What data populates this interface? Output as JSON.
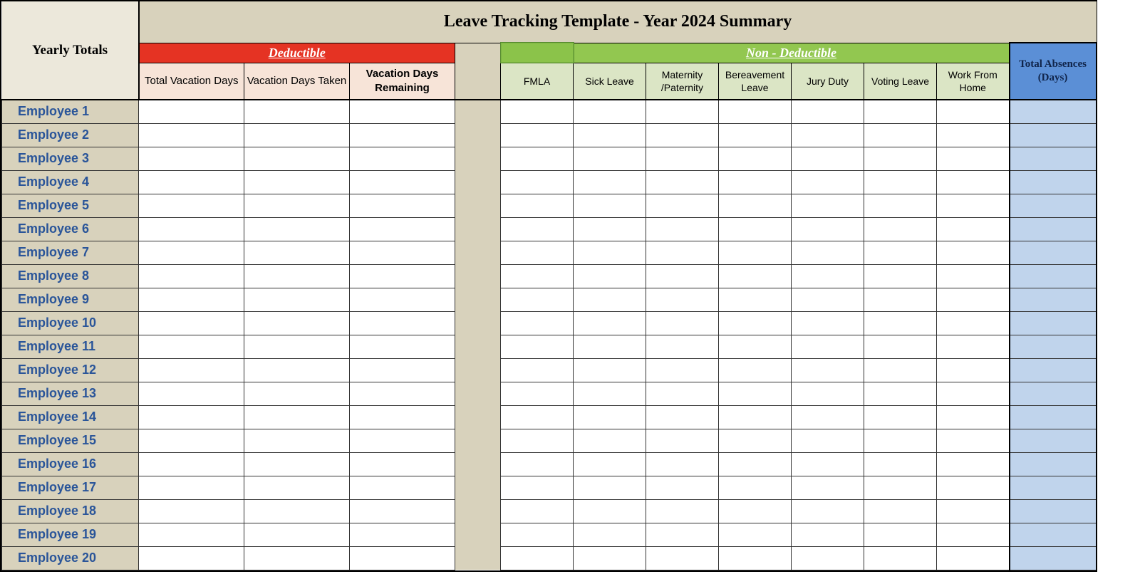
{
  "title": "Leave Tracking Template - Year 2024 Summary",
  "yearly_totals_label": "Yearly Totals",
  "deductible": {
    "header": "Deductible",
    "columns": [
      "Total Vacation Days",
      "Vacation Days Taken",
      "Vacation Days Remaining"
    ]
  },
  "nondeductible": {
    "header": "Non - Deductible",
    "columns": [
      "FMLA",
      "Sick Leave",
      "Maternity /Paternity",
      "Bereavement Leave",
      "Jury Duty",
      "Voting Leave",
      "Work From Home"
    ]
  },
  "total_absences_header": "Total Absences (Days)",
  "employees": [
    "Employee 1",
    "Employee 2",
    "Employee 3",
    "Employee 4",
    "Employee 5",
    "Employee 6",
    "Employee 7",
    "Employee 8",
    "Employee 9",
    "Employee 10",
    "Employee 11",
    "Employee 12",
    "Employee 13",
    "Employee 14",
    "Employee 15",
    "Employee 16",
    "Employee 17",
    "Employee 18",
    "Employee 19",
    "Employee 20"
  ]
}
